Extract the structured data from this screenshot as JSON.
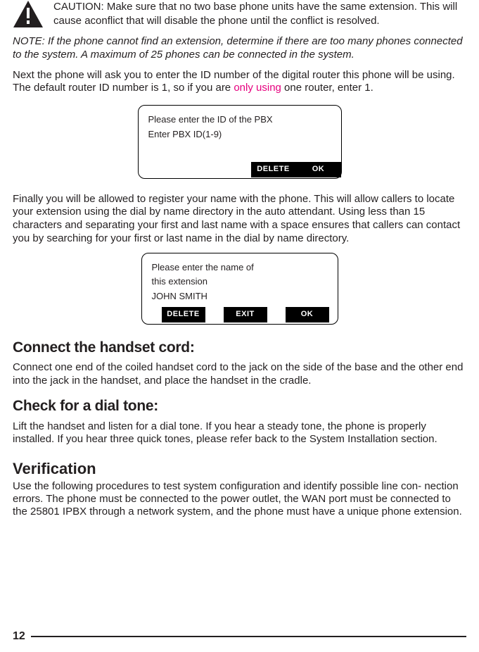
{
  "caution": {
    "text": "CAUTION: Make sure that no two base phone units have the same extension. This will cause aconflict that will disable the phone until the conflict is resolved."
  },
  "note": {
    "text": "NOTE: If the phone cannot find an extension, determine if there are too many phones connected to the system. A maximum of 25 phones can be connected in the system."
  },
  "para1": {
    "pre": "Next the phone will ask you to enter the ID number of the digital router this phone will be using. The default router ID number is 1, so if you are ",
    "hl": "only using",
    "post": " one router, enter 1."
  },
  "screen1": {
    "line1": "Please enter the ID of the PBX",
    "line2": "Enter PBX ID(1-9)",
    "btn_delete": "DELETE",
    "btn_ok": "OK"
  },
  "para2": {
    "text": "Finally you will be allowed to register your name with the phone. This will allow callers to locate your extension using the dial by name directory in the auto attendant. Using less than 15 characters and separating your first and last name with a space ensures that callers can contact you by searching for your first or last name in the dial by name directory."
  },
  "screen2": {
    "line1": "Please enter the name of",
    "line2": "this extension",
    "line3": "JOHN SMITH",
    "btn_delete": "DELETE",
    "btn_exit": "EXIT",
    "btn_ok": "OK"
  },
  "sections": {
    "connect": {
      "heading": "Connect the handset cord:",
      "body": "Connect one end of the coiled handset cord to the jack on the side of the base and the other end into the jack in the handset, and place the handset in the cradle."
    },
    "dialtone": {
      "heading": "Check for a dial tone:",
      "body": "Lift the handset and listen for a dial tone. If you hear a steady tone, the phone is properly installed.  If you hear three quick tones, please refer back to the System Installation section."
    },
    "verification": {
      "heading": "Verification",
      "body": "Use the following procedures to test system configuration and identify possible line con- nection errors. The phone must be connected to the power outlet, the WAN port must be connected to the 25801 IPBX through a network system, and the phone must have a unique phone extension."
    }
  },
  "page_number": "12"
}
